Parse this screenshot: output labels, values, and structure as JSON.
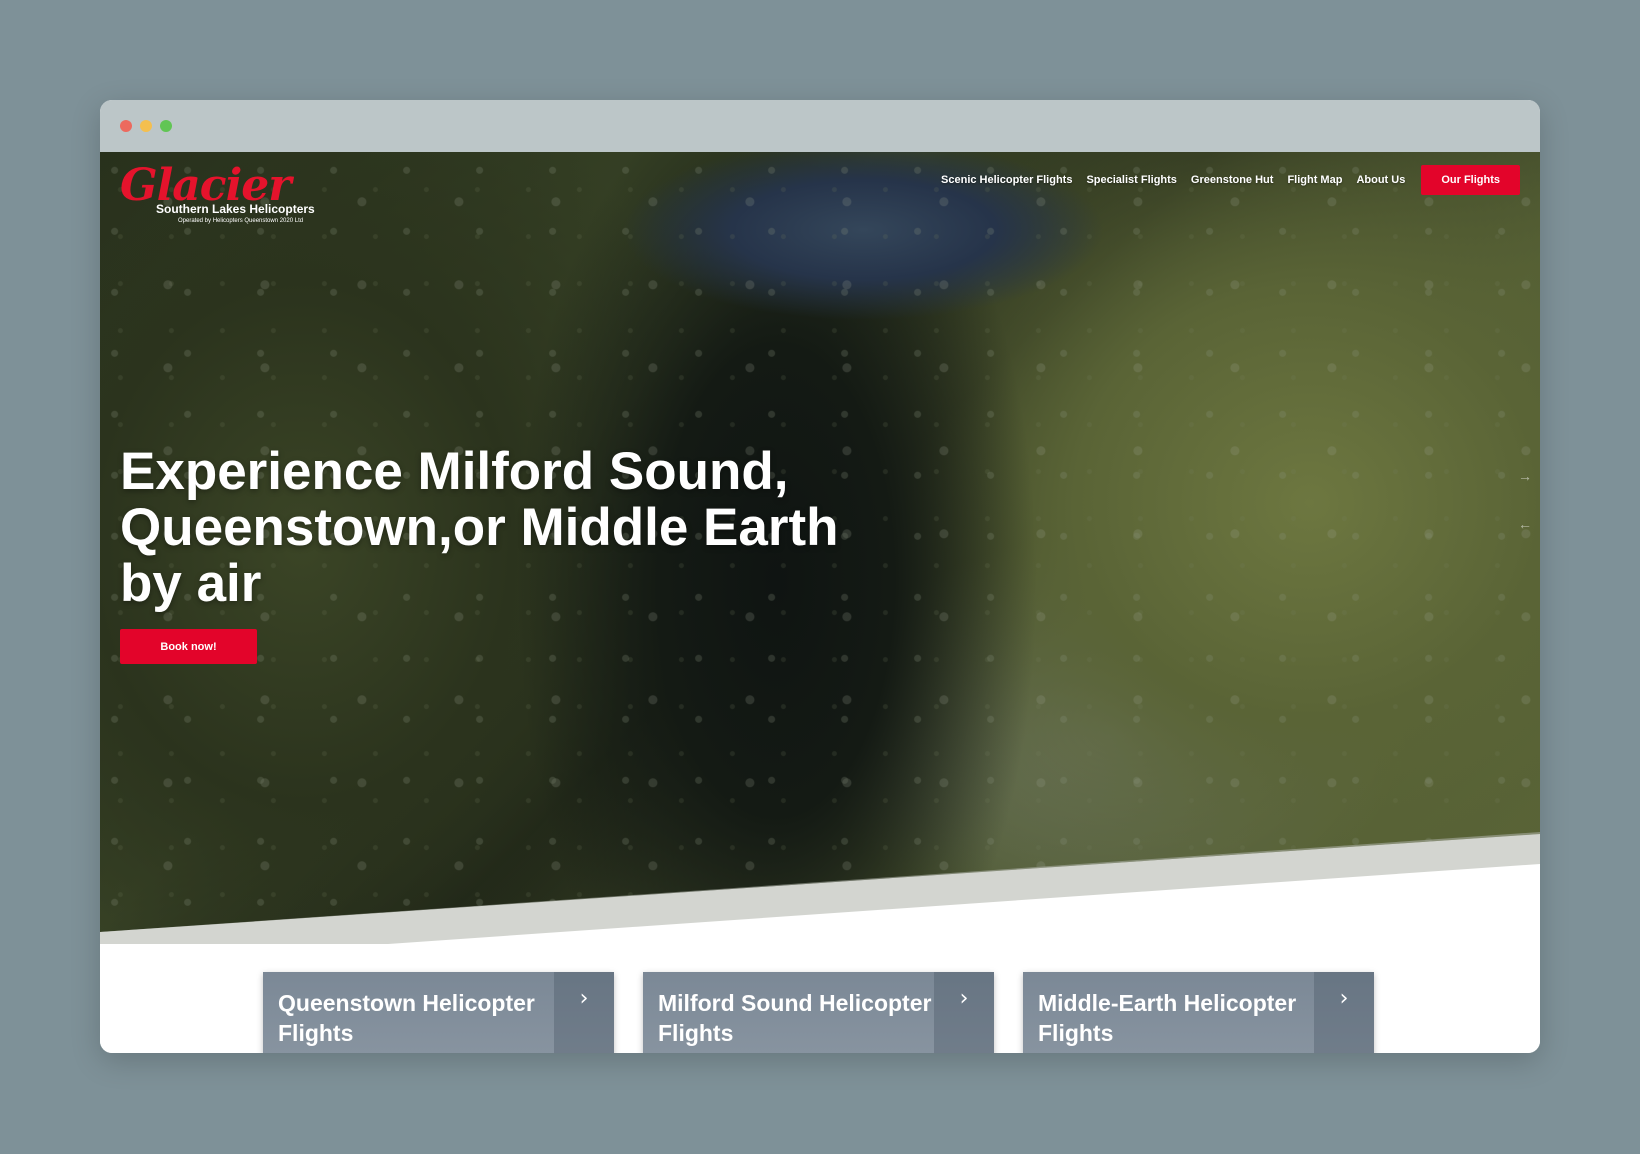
{
  "logo": {
    "script_text": "Glacier",
    "company": "Southern Lakes Helicopters",
    "operator_note": "Operated by Helicopters Queenstown 2020 Ltd",
    "brand_color": "#e3042a"
  },
  "nav": {
    "items": [
      {
        "label": "Scenic Helicopter Flights"
      },
      {
        "label": "Specialist Flights"
      },
      {
        "label": "Greenstone Hut"
      },
      {
        "label": "Flight Map"
      },
      {
        "label": "About Us"
      }
    ],
    "cta_label": "Our Flights"
  },
  "hero": {
    "title": "Experience Milford Sound, Queenstown,or Middle Earth by air",
    "button_label": "Book now!",
    "next_arrow": "→",
    "prev_arrow": "←"
  },
  "cards": [
    {
      "title": "Queenstown Helicopter Flights",
      "chevron": "›"
    },
    {
      "title": "Milford Sound Helicopter Flights",
      "chevron": "›"
    },
    {
      "title": "Middle-Earth Helicopter Flights",
      "chevron": "›"
    }
  ]
}
